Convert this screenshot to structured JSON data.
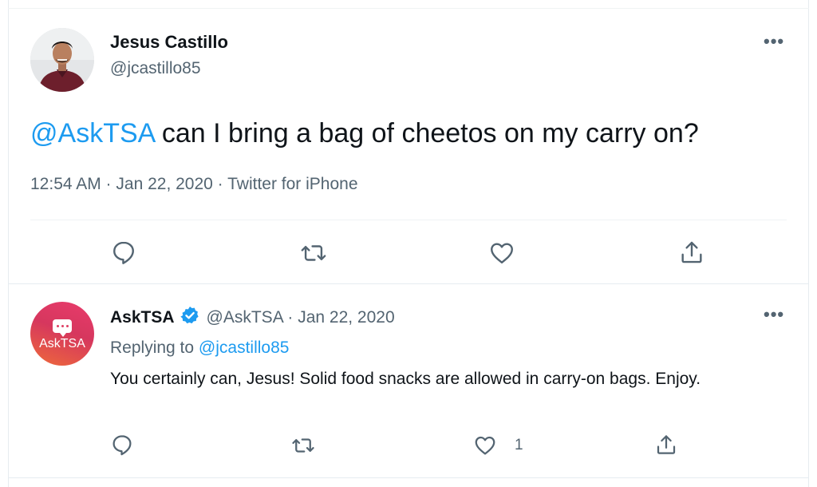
{
  "main_tweet": {
    "author_name": "Jesus Castillo",
    "author_handle": "@jcastillo85",
    "mention": "@AskTSA",
    "text": " can I bring a bag of cheetos on my carry on?",
    "timestamp": "12:54 AM · Jan 22, 2020 · Twitter for iPhone",
    "actions": [
      "reply-icon",
      "retweet-icon",
      "like-icon",
      "share-icon"
    ]
  },
  "reply_tweet": {
    "author_name": "AskTSA",
    "avatar_text": "AskTSA",
    "verified": true,
    "handle_date": "@AskTSA · Jan 22, 2020",
    "replying_prefix": "Replying to ",
    "replying_to": "@jcastillo85",
    "text": "You certainly can, Jesus! Solid food snacks are allowed in carry-on bags. Enjoy.",
    "like_count": "1",
    "actions": [
      "reply-icon",
      "retweet-icon",
      "like-icon",
      "share-icon"
    ]
  },
  "more_label": "•••",
  "colors": {
    "accent": "#1d9bf0",
    "secondary_text": "#536471",
    "primary_text": "#0f1419",
    "verified": "#1d9bf0"
  }
}
